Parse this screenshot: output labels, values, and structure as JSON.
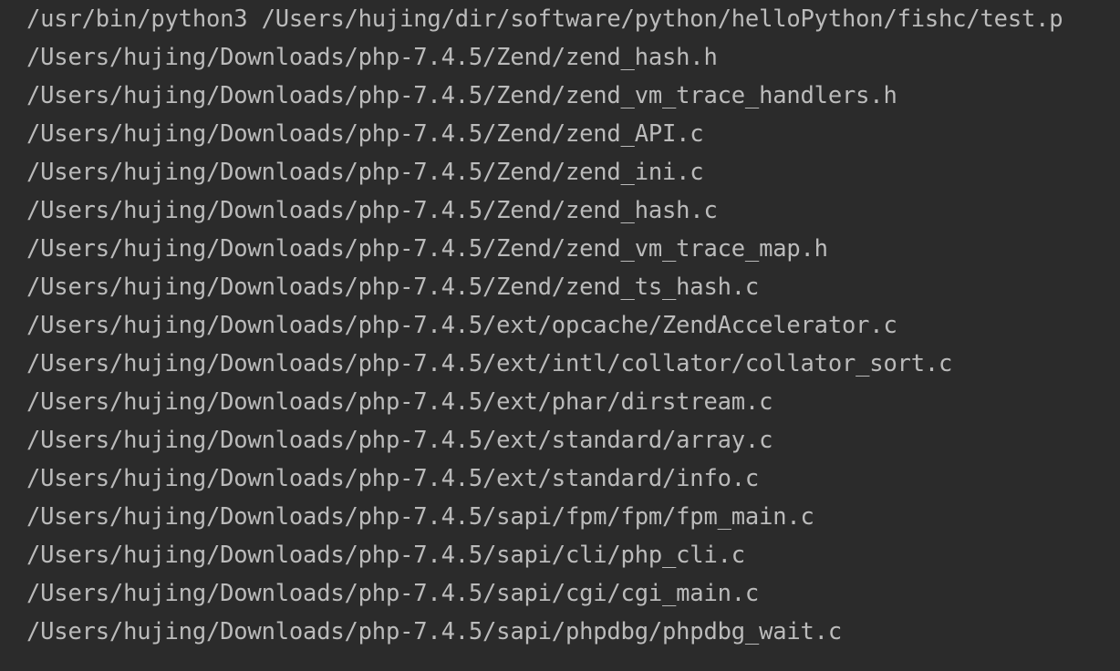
{
  "console": {
    "lines": [
      "/usr/bin/python3 /Users/hujing/dir/software/python/helloPython/fishc/test.p",
      "/Users/hujing/Downloads/php-7.4.5/Zend/zend_hash.h",
      "/Users/hujing/Downloads/php-7.4.5/Zend/zend_vm_trace_handlers.h",
      "/Users/hujing/Downloads/php-7.4.5/Zend/zend_API.c",
      "/Users/hujing/Downloads/php-7.4.5/Zend/zend_ini.c",
      "/Users/hujing/Downloads/php-7.4.5/Zend/zend_hash.c",
      "/Users/hujing/Downloads/php-7.4.5/Zend/zend_vm_trace_map.h",
      "/Users/hujing/Downloads/php-7.4.5/Zend/zend_ts_hash.c",
      "/Users/hujing/Downloads/php-7.4.5/ext/opcache/ZendAccelerator.c",
      "/Users/hujing/Downloads/php-7.4.5/ext/intl/collator/collator_sort.c",
      "/Users/hujing/Downloads/php-7.4.5/ext/phar/dirstream.c",
      "/Users/hujing/Downloads/php-7.4.5/ext/standard/array.c",
      "/Users/hujing/Downloads/php-7.4.5/ext/standard/info.c",
      "/Users/hujing/Downloads/php-7.4.5/sapi/fpm/fpm/fpm_main.c",
      "/Users/hujing/Downloads/php-7.4.5/sapi/cli/php_cli.c",
      "/Users/hujing/Downloads/php-7.4.5/sapi/cgi/cgi_main.c",
      "/Users/hujing/Downloads/php-7.4.5/sapi/phpdbg/phpdbg_wait.c"
    ]
  },
  "colors": {
    "background": "#2b2b2b",
    "text": "#bbbbbb"
  }
}
